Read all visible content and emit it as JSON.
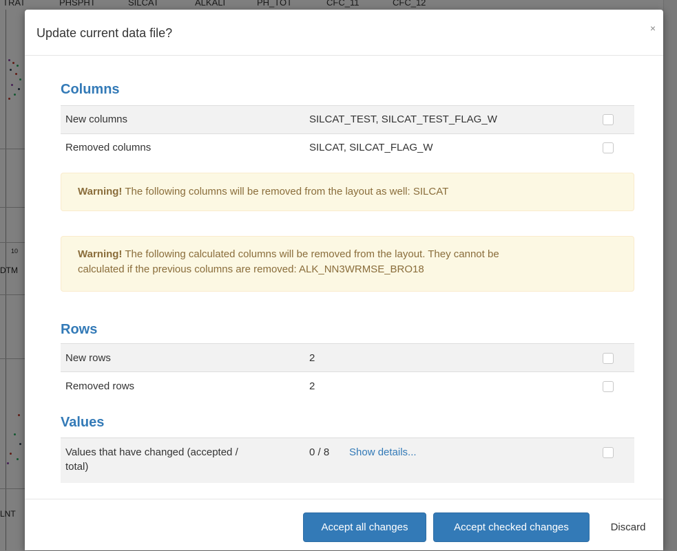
{
  "background": {
    "column_headers": [
      "TRAT",
      "PHSPHT",
      "SILCAT",
      "ALKALI",
      "PH_TOT",
      "CFC_11",
      "CFC_12"
    ],
    "axis_labels": [
      "10",
      "DTM",
      "LNT"
    ]
  },
  "modal": {
    "title": "Update current data file?",
    "close_glyph": "×",
    "sections": {
      "columns": {
        "title": "Columns",
        "rows": [
          {
            "label": "New columns",
            "value": "SILCAT_TEST, SILCAT_TEST_FLAG_W"
          },
          {
            "label": "Removed columns",
            "value": "SILCAT, SILCAT_FLAG_W"
          }
        ],
        "warnings": [
          {
            "strong": "Warning!",
            "text_line1": " The following columns will be removed from the layout as well: SILCAT"
          },
          {
            "strong": "Warning!",
            "text_line1": " The following calculated columns will be removed from the layout. They cannot be",
            "text_line2": "calculated if the previous columns are removed: ALK_NN3WRMSE_BRO18"
          }
        ]
      },
      "rows": {
        "title": "Rows",
        "rows": [
          {
            "label": "New rows",
            "value": "2"
          },
          {
            "label": "Removed rows",
            "value": "2"
          }
        ]
      },
      "values": {
        "title": "Values",
        "row": {
          "label_line1": "Values that have changed (accepted /",
          "label_line2": "total)",
          "value": "0 / 8",
          "link": "Show details..."
        }
      }
    },
    "footer": {
      "accept_all": "Accept all changes",
      "accept_checked": "Accept checked changes",
      "discard": "Discard"
    }
  },
  "colors": {
    "accent": "#337ab7",
    "warning_bg": "#fcf8e3",
    "warning_text": "#8a6d3b",
    "overlay": "rgba(0,0,0,0.5)"
  },
  "icons": {
    "close": "close-icon"
  }
}
